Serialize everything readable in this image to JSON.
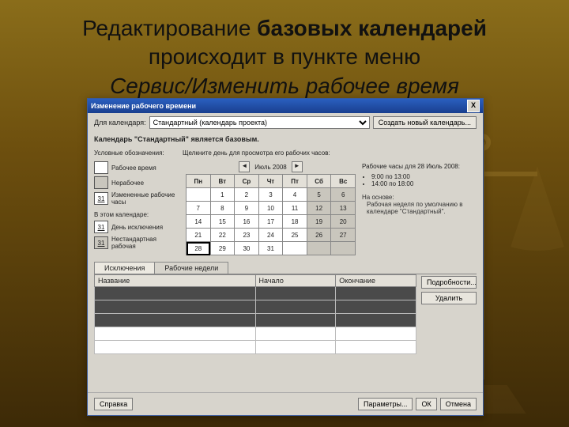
{
  "heading": {
    "pre": "Редактирование ",
    "bold": "базовых календарей",
    "line2": "происходит в пункте меню",
    "italic": "Сервис/Изменить рабочее время"
  },
  "dialog": {
    "title": "Изменение рабочего времени",
    "close_x": "X",
    "for_label": "Для календаря:",
    "calendar_selected": "Стандартный (календарь проекта)",
    "new_cal_btn": "Создать новый календарь...",
    "base_text": "Календарь \"Стандартный\" является базовым.",
    "legend_title": "Условные обозначения:",
    "click_hint": "Щелкните день для просмотра его рабочих часов:",
    "legend": {
      "work": "Рабочее время",
      "nonwork": "Нерабочее",
      "changed": "Измененные рабочие часы",
      "on_this": "В этом календаре:",
      "exc": "День исключения",
      "nonstd": "Нестандартная рабочая",
      "d31": "31"
    },
    "month": {
      "title": "Июль 2008",
      "dow": [
        "Пн",
        "Вт",
        "Ср",
        "Чт",
        "Пт",
        "Сб",
        "Вс"
      ],
      "weeks": [
        [
          "",
          "1",
          "2",
          "3",
          "4",
          "5",
          "6"
        ],
        [
          "7",
          "8",
          "9",
          "10",
          "11",
          "12",
          "13"
        ],
        [
          "14",
          "15",
          "16",
          "17",
          "18",
          "19",
          "20"
        ],
        [
          "21",
          "22",
          "23",
          "24",
          "25",
          "26",
          "27"
        ],
        [
          "28",
          "29",
          "30",
          "31",
          "",
          "",
          ""
        ]
      ],
      "selected": "28"
    },
    "hours": {
      "title": "Рабочие часы для 28 Июль 2008:",
      "h1": "9:00 по 13:00",
      "h2": "14:00 по 18:00",
      "basis_label": "На основе:",
      "basis_text": "Рабочая неделя по умолчанию в календаре \"Стандартный\"."
    },
    "tabs": {
      "exc": "Исключения",
      "weeks": "Рабочие недели"
    },
    "table": {
      "name": "Название",
      "start": "Начало",
      "end": "Окончание"
    },
    "details_btn": "Подробности...",
    "delete_btn": "Удалить",
    "help_btn": "Справка",
    "options_btn": "Параметры...",
    "ok_btn": "ОК",
    "cancel_btn": "Отмена"
  }
}
